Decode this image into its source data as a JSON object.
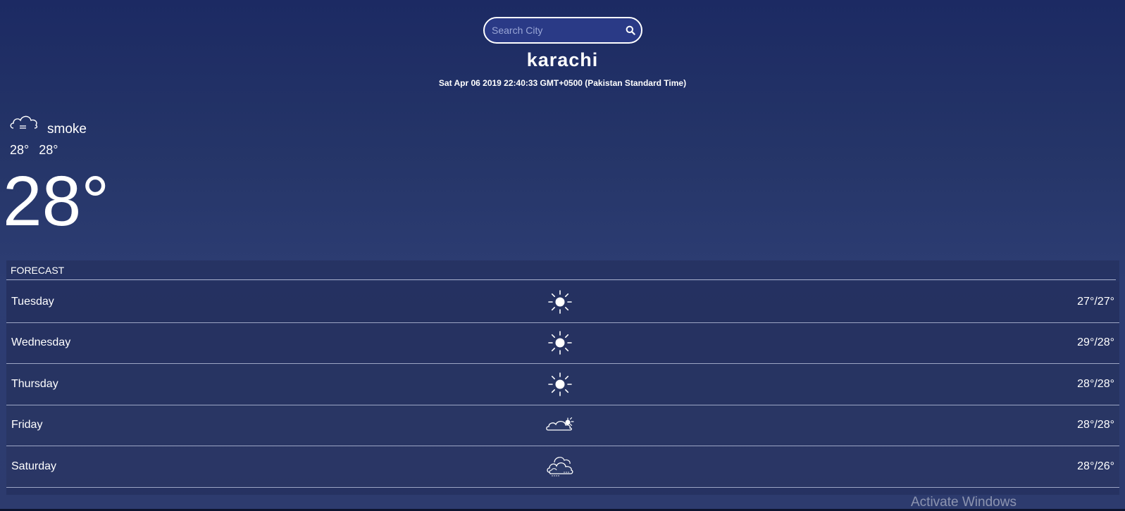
{
  "search": {
    "placeholder": "Search City",
    "icon": "search-icon"
  },
  "location": {
    "city": "karachi",
    "datetime": "Sat Apr 06 2019 22:40:33 GMT+0500 (Pakistan Standard Time)"
  },
  "current": {
    "icon": "smoke-cloud-icon",
    "condition": "smoke",
    "temp_min": "28°",
    "temp_max": "28°",
    "temp": "28°"
  },
  "forecast": {
    "title": "FORECAST",
    "days": [
      {
        "day": "Tuesday",
        "icon": "sun-icon",
        "temps": "27°/27°"
      },
      {
        "day": "Wednesday",
        "icon": "sun-icon",
        "temps": "29°/28°"
      },
      {
        "day": "Thursday",
        "icon": "sun-icon",
        "temps": "28°/28°"
      },
      {
        "day": "Friday",
        "icon": "cloud-sun-icon",
        "temps": "28°/28°"
      },
      {
        "day": "Saturday",
        "icon": "cloudy-rain-icon",
        "temps": "28°/26°"
      }
    ]
  },
  "watermark": "Activate Windows",
  "colors": {
    "background_top": "#1c2a63",
    "background_bottom": "#2d3b6e",
    "search_bg": "#2a3a86",
    "text": "#ffffff"
  }
}
